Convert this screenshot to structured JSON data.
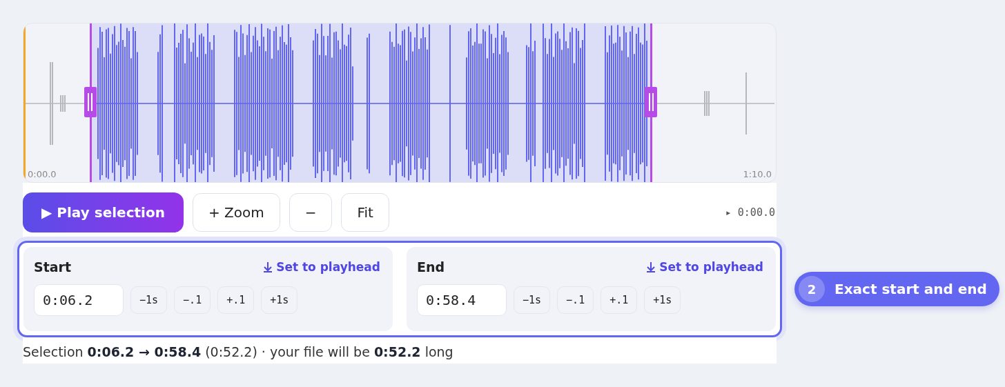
{
  "waveform": {
    "start_label": "0:00.0",
    "end_label": "1:10.0"
  },
  "toolbar": {
    "play_button": "▶ Play selection",
    "zoom_in_button": "+ Zoom",
    "zoom_out_button": "−",
    "fit_button": "Fit",
    "playhead_reading": "▸ 0:00.0"
  },
  "editors": [
    {
      "label": "Start",
      "link": "Set to playhead",
      "value": "0:06.2",
      "nudges": [
        "−1s",
        "−.1",
        "+.1",
        "+1s"
      ]
    },
    {
      "label": "End",
      "link": "Set to playhead",
      "value": "0:58.4",
      "nudges": [
        "−1s",
        "−.1",
        "+.1",
        "+1s"
      ]
    }
  ],
  "summary": "Selection **0:06.2 → 0:58.4** (0:52.2) · your file will be **0:52.2** long",
  "callout": {
    "number": "2",
    "text": "Exact start and end"
  }
}
